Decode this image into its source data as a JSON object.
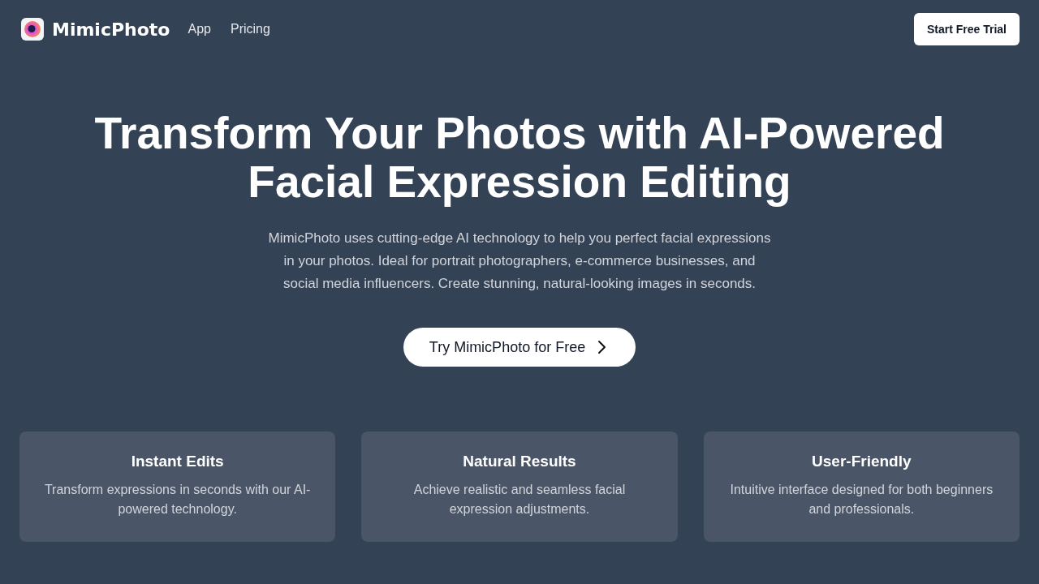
{
  "brand": "MimicPhoto",
  "nav": [
    {
      "label": "App"
    },
    {
      "label": "Pricing"
    }
  ],
  "header_button": "Start Free Trial",
  "hero": {
    "title_lines": [
      "Transform Your Photos with AI-Powered",
      "Facial Expression Editing"
    ],
    "description": "MimicPhoto uses cutting-edge AI technology to help you perfect facial expressions in your photos. Ideal for portrait photographers, e-commerce businesses, and social media influencers. Create stunning, natural-looking images in seconds.",
    "cta": "Try MimicPhoto for Free"
  },
  "features": [
    {
      "title": "Instant Edits",
      "text": "Transform expressions in seconds with our AI-powered technology."
    },
    {
      "title": "Natural Results",
      "text": "Achieve realistic and seamless facial expression adjustments."
    },
    {
      "title": "User-Friendly",
      "text": "Intuitive interface designed for both beginners and professionals."
    }
  ]
}
